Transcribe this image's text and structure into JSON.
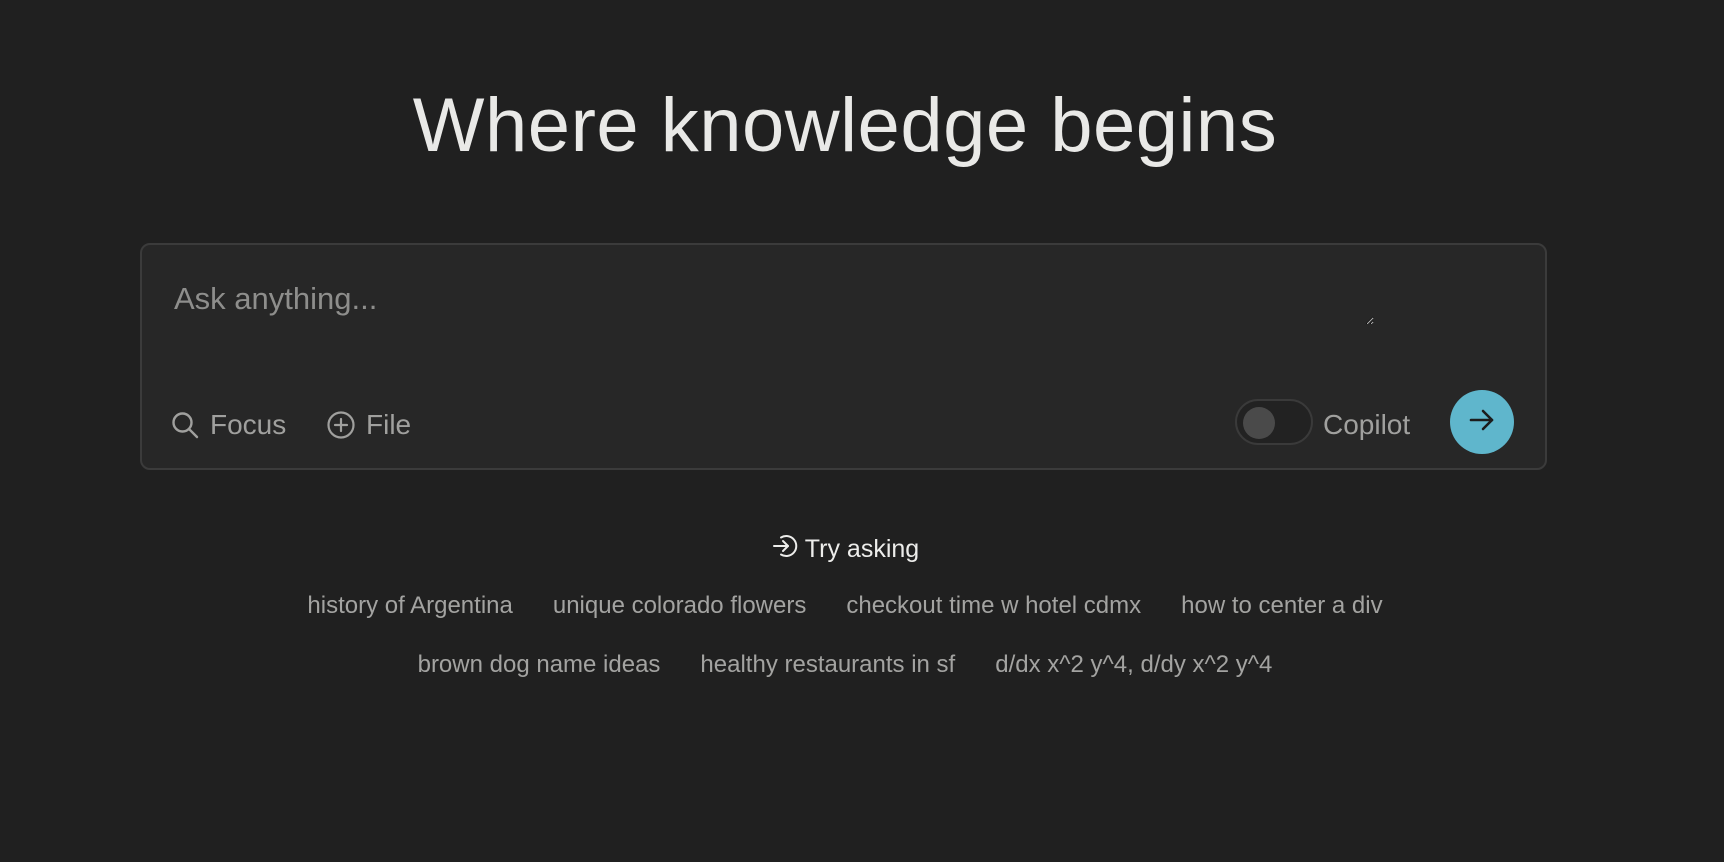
{
  "hero": {
    "title": "Where knowledge begins"
  },
  "search": {
    "placeholder": "Ask anything...",
    "value": "",
    "focus_label": "Focus",
    "file_label": "File",
    "copilot_label": "Copilot",
    "copilot_enabled": false,
    "submit_icon": "arrow-right-icon",
    "accent_color": "#5fb6cc"
  },
  "suggestions": {
    "heading": "Try asking",
    "heading_icon": "arrow-into-circle-icon",
    "row1": [
      "history of Argentina",
      "unique colorado flowers",
      "checkout time w hotel cdmx",
      "how to center a div"
    ],
    "row2": [
      "brown dog name ideas",
      "healthy restaurants in sf",
      "d/dx x^2 y^4, d/dy x^2 y^4"
    ]
  }
}
